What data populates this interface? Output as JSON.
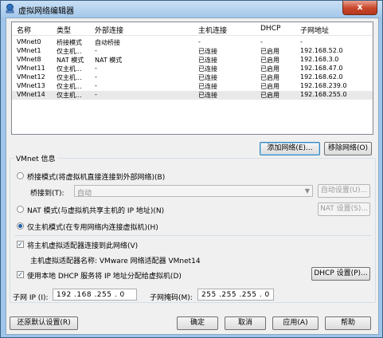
{
  "window": {
    "title": "虚拟网络编辑器",
    "close_glyph": "x"
  },
  "table": {
    "headers": [
      "名称",
      "类型",
      "外部连接",
      "主机连接",
      "DHCP",
      "子网地址"
    ],
    "rows": [
      [
        "VMnet0",
        "桥接模式",
        "自动桥接",
        "-",
        "-",
        "-"
      ],
      [
        "VMnet1",
        "仅主机...",
        "-",
        "已连接",
        "已启用",
        "192.168.52.0"
      ],
      [
        "VMnet8",
        "NAT 模式",
        "NAT 模式",
        "已连接",
        "已启用",
        "192.168.3.0"
      ],
      [
        "VMnet11",
        "仅主机...",
        "-",
        "已连接",
        "已启用",
        "192.168.47.0"
      ],
      [
        "VMnet12",
        "仅主机...",
        "-",
        "已连接",
        "已启用",
        "192.168.62.0"
      ],
      [
        "VMnet13",
        "仅主机...",
        "-",
        "已连接",
        "已启用",
        "192.168.239.0"
      ],
      [
        "VMnet14",
        "仅主机...",
        "-",
        "已连接",
        "已启用",
        "192.168.255.0"
      ]
    ],
    "selected_row": "VMnet14"
  },
  "buttons": {
    "add_network": "添加网络(E)...",
    "remove_network": "移除网络(O)",
    "auto_settings": "自动设置(U)...",
    "nat_settings": "NAT 设置(S)...",
    "dhcp_settings": "DHCP 设置(P)...",
    "restore_defaults": "还原默认设置(R)",
    "ok": "确定",
    "cancel": "取消",
    "apply": "应用(A)",
    "help": "帮助"
  },
  "vmnet_info": {
    "title": "VMnet 信息",
    "bridged_label": "桥接模式(将虚拟机直接连接到外部网络)(B)",
    "bridged_to_label": "桥接到(T):",
    "bridged_to_value": "自动",
    "nat_label": "NAT 模式(与虚拟机共享主机的 IP 地址)(N)",
    "host_only_label": "仅主机模式(在专用网络内连接虚拟机)(H)",
    "selected_mode": "host_only",
    "connect_adapter_label": "将主机虚拟适配器连接到此网络(V)",
    "connect_adapter_checked": true,
    "adapter_name_label": "主机虚拟适配器名称: VMware 网络适配器 VMnet14",
    "dhcp_label": "使用本地 DHCP 服务将 IP 地址分配给虚拟机(D)",
    "dhcp_checked": true,
    "subnet_ip_label": "子网 IP (I):",
    "subnet_ip_value": "192 .168 .255 . 0",
    "subnet_mask_label": "子网掩码(M):",
    "subnet_mask_value": "255 .255 .255 . 0"
  },
  "colors": {
    "selection": "#e9e9e9",
    "title_bar": "#a5c8ea",
    "close_button": "#c8452a"
  }
}
